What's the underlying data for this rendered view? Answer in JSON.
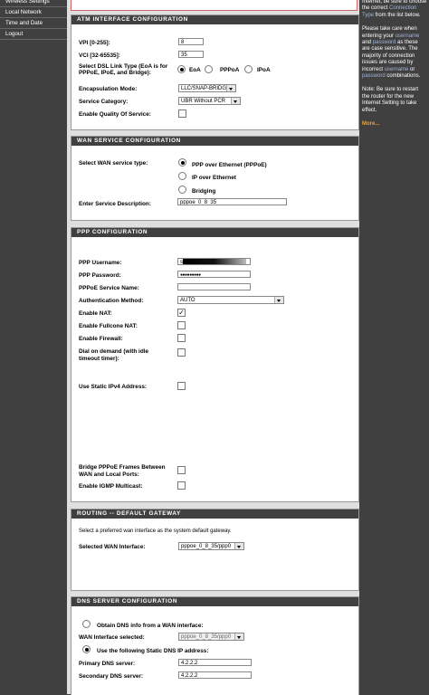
{
  "sidebar": {
    "items": [
      {
        "label": "Wireless Settings"
      },
      {
        "label": "Local Network"
      },
      {
        "label": "Time and Date"
      },
      {
        "label": "Logout"
      }
    ]
  },
  "atm": {
    "title": "ATM INTERFACE CONFIGURATION",
    "vpi_label": "VPI [0-255]:",
    "vpi_value": "8",
    "vci_label": "VCI [32-65535]:",
    "vci_value": "35",
    "dsl_type_label": "Select DSL Link Type (EoA is for PPPoE, IPoE, and Bridge):",
    "opt_eoa": "EoA",
    "opt_pppoa": "PPPoA",
    "opt_ipoa": "IPoA",
    "encap_label": "Encapsulation Mode:",
    "encap_value": "LLC/SNAP-BRIDGING",
    "service_label": "Service Category:",
    "service_value": "UBR Without PCR",
    "qos_label": "Enable Quality Of Service:"
  },
  "wan": {
    "title": "WAN SERVICE CONFIGURATION",
    "type_label": "Select WAN service type:",
    "opt_pppoe": "PPP over Ethernet (PPPoE)",
    "opt_ipoe": "IP over Ethernet",
    "opt_bridging": "Bridging",
    "desc_label": "Enter Service Description:",
    "desc_value": "pppoe_0_8_35"
  },
  "ppp": {
    "title": "PPP CONFIGURATION",
    "username_label": "PPP Username:",
    "username_prefix": "s",
    "password_label": "PPP Password:",
    "password_value": "●●●●●●●●●",
    "service_name_label": "PPPoE Service Name:",
    "auth_label": "Authentication Method:",
    "auth_value": "AUTO",
    "nat_label": "Enable NAT:",
    "check_mark": "✓",
    "fullcone_label": "Enable Fullcone NAT:",
    "firewall_label": "Enable Firewall:",
    "dial_label_1": "Dial on demand (with idle",
    "dial_label_2": "timeout timer):",
    "static_ip_label": "Use Static IPv4 Address:",
    "bridge_label_1": "Bridge PPPoE Frames Between",
    "bridge_label_2": "WAN and Local Ports:",
    "igmp_label": "Enable IGMP Multicast:"
  },
  "routing": {
    "title": "ROUTING -- DEFAULT GATEWAY",
    "desc": "Select a preferred wan interface as the system default gateway.",
    "wan_label": "Selected WAN Interface:",
    "wan_value": "pppoe_0_8_35/ppp0"
  },
  "dns": {
    "title": "DNS SERVER CONFIGURATION",
    "opt_obtain": "Obtain DNS info from a WAN interface:",
    "wan_sel_label": "WAN Interface selected:",
    "wan_sel_value": "pppoe_0_8_35/ppp0",
    "opt_static": "Use the following Static DNS IP address:",
    "primary_label": "Primary DNS server:",
    "primary_value": "4.2.2.2",
    "secondary_label": "Secondary DNS server:",
    "secondary_value": "4.2.2.2"
  },
  "help": {
    "p1_a": "Internet, be sure to choose the correct ",
    "p1_link": "Connection Type",
    "p1_b": " from the list below.",
    "p2_a": "Please take care when entering your ",
    "p2_user": "username",
    "p2_b": " and ",
    "p2_pass": "password",
    "p2_c": " as these are case sensitive. The majority of connection issues are caused by incorrect ",
    "p2_user2": "username",
    "p2_d": " or ",
    "p2_pass2": "password",
    "p2_e": " combinations.",
    "p3": "Note: Be sure to restart the router for the new Internet Setting to take effect.",
    "more": "More..."
  }
}
